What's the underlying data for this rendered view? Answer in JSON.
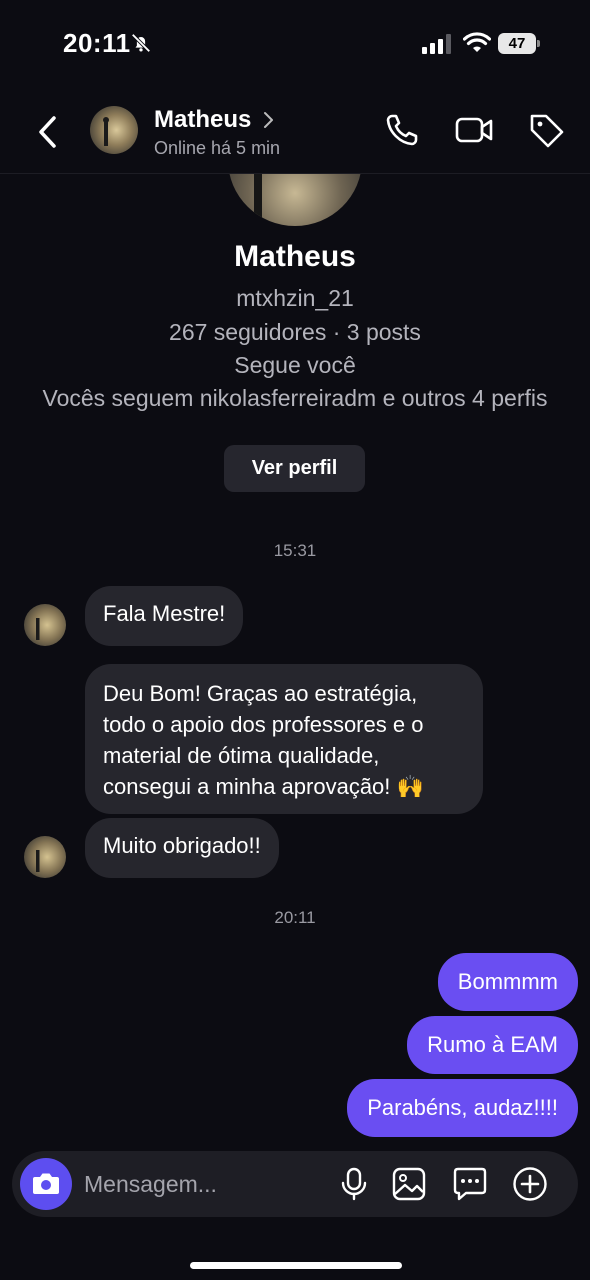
{
  "status_bar": {
    "time": "20:11",
    "battery": "47"
  },
  "header": {
    "name": "Matheus",
    "status": "Online há 5 min"
  },
  "profile": {
    "name": "Matheus",
    "username": "mtxhzin_21",
    "stats": "267 seguidores · 3 posts",
    "follows_you": "Segue você",
    "mutuals": "Vocês seguem nikolasferreiradm e outros 4 perfis",
    "view_button": "Ver perfil"
  },
  "timestamps": [
    "15:31",
    "20:11"
  ],
  "incoming": [
    "Fala Mestre!",
    "Deu Bom! Graças ao estratégia, todo o apoio dos professores e o material de ótima qualidade, consegui a minha aprovação! 🙌",
    "Muito obrigado!!"
  ],
  "outgoing": [
    "Bommmm",
    "Rumo à EAM",
    "Parabéns, audaz!!!!"
  ],
  "composer": {
    "placeholder": "Mensagem..."
  },
  "colors": {
    "accent": "#6a4ef2",
    "background": "#0c0c12",
    "bubble_in": "#26262d"
  },
  "icons": [
    "back-icon",
    "phone-icon",
    "video-call-icon",
    "tag-icon",
    "camera-icon",
    "mic-icon",
    "gallery-icon",
    "sticker-icon",
    "plus-icon"
  ]
}
